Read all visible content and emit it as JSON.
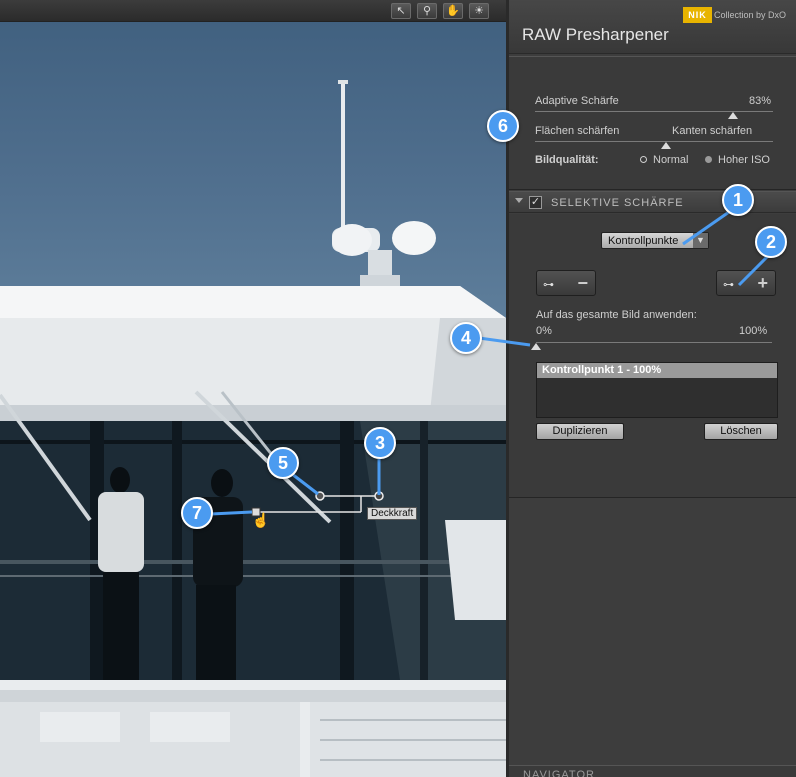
{
  "toolbar": {
    "tools": [
      {
        "name": "select-tool-icon",
        "glyph": "↖"
      },
      {
        "name": "zoom-tool-icon",
        "glyph": "⚲"
      },
      {
        "name": "hand-tool-icon",
        "glyph": "✋"
      },
      {
        "name": "brightness-tool-icon",
        "glyph": "☀"
      }
    ]
  },
  "panel": {
    "logo_text": "NIK",
    "brand": "Collection by DxO",
    "title": "RAW Presharpener",
    "adaptive_label": "Adaptive Schärfe",
    "adaptive_value": "83%",
    "adaptive_level": 0.83,
    "flaechen_label": "Flächen schärfen",
    "kanten_label": "Kanten schärfen",
    "balance_level": 0.55,
    "quality_label": "Bildqualität:",
    "quality_normal": "Normal",
    "quality_high": "Hoher ISO",
    "quality_selected": "Hoher ISO"
  },
  "selective": {
    "checked": true,
    "title": "SELEKTIVE SCHÄRFE",
    "mode": "Kontrollpunkte",
    "apply_label": "Auf das gesamte Bild anwenden:",
    "apply_min": "0%",
    "apply_max": "100%",
    "apply_level": 0,
    "list": [
      "Kontrollpunkt 1 - 100%"
    ],
    "duplicate_label": "Duplizieren",
    "delete_label": "Löschen",
    "remove_sign": "−",
    "add_sign": "+"
  },
  "overlay": {
    "opacity_label": "Deckkraft"
  },
  "navigator_label": "NAVIGATOR",
  "callouts": [
    "1",
    "2",
    "3",
    "4",
    "5",
    "6",
    "7"
  ]
}
